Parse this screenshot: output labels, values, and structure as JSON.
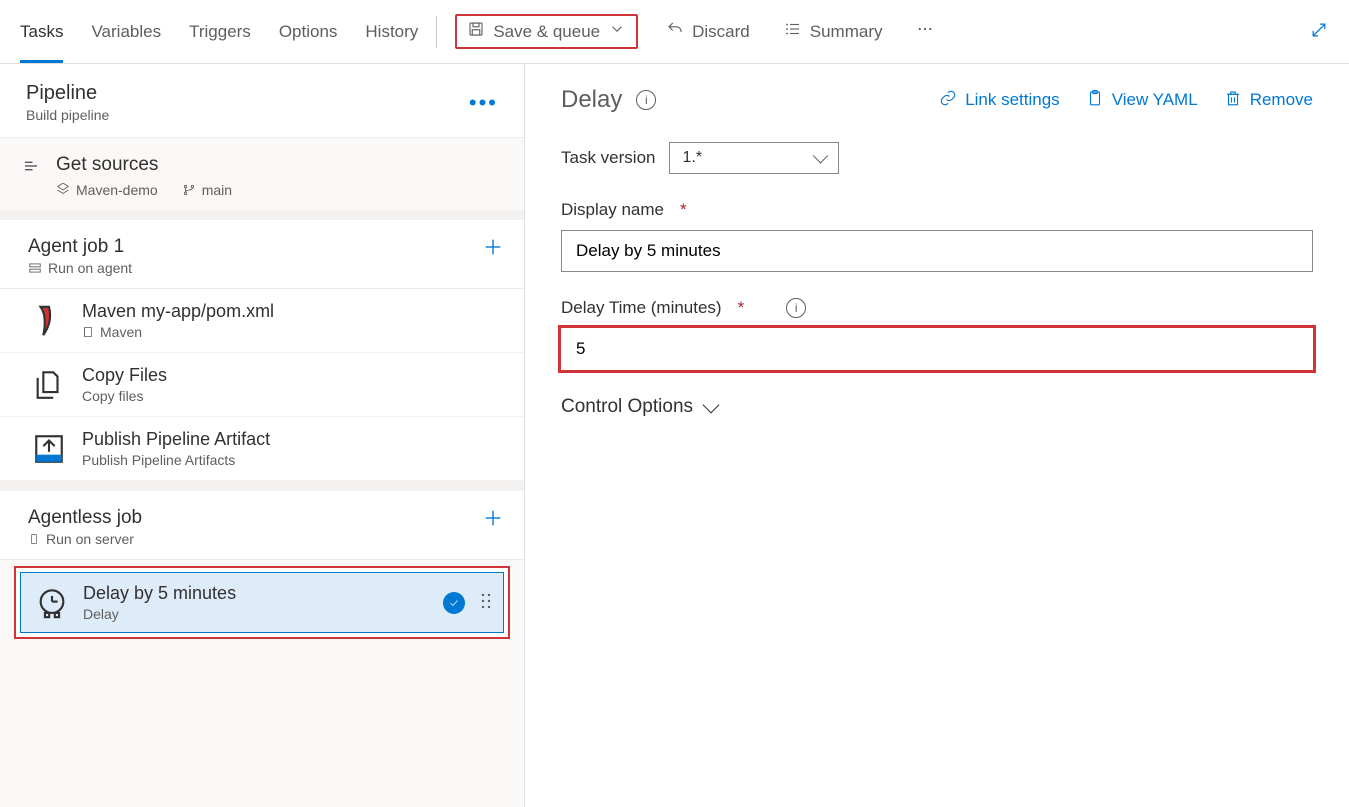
{
  "tabs": [
    "Tasks",
    "Variables",
    "Triggers",
    "Options",
    "History"
  ],
  "activeTab": 0,
  "commands": {
    "save_queue": "Save & queue",
    "discard": "Discard",
    "summary": "Summary"
  },
  "sidebar": {
    "pipeline_title": "Pipeline",
    "pipeline_sub": "Build pipeline",
    "get_sources": "Get sources",
    "repo_name": "Maven-demo",
    "branch_name": "main",
    "job1_title": "Agent job 1",
    "job1_sub": "Run on agent",
    "tasks1": [
      {
        "name": "Maven my-app/pom.xml",
        "sub": "Maven",
        "icon": "maven"
      },
      {
        "name": "Copy Files",
        "sub": "Copy files",
        "icon": "copy"
      },
      {
        "name": "Publish Pipeline Artifact",
        "sub": "Publish Pipeline Artifacts",
        "icon": "publish"
      }
    ],
    "job2_title": "Agentless job",
    "job2_sub": "Run on server",
    "selected_task": {
      "name": "Delay by 5 minutes",
      "sub": "Delay"
    }
  },
  "main": {
    "title": "Delay",
    "link_settings": "Link settings",
    "view_yaml": "View YAML",
    "remove": "Remove",
    "task_version_label": "Task version",
    "task_version_value": "1.*",
    "display_name_label": "Display name",
    "display_name_value": "Delay by 5 minutes",
    "delay_time_label": "Delay Time (minutes)",
    "delay_time_value": "5",
    "control_options": "Control Options"
  }
}
